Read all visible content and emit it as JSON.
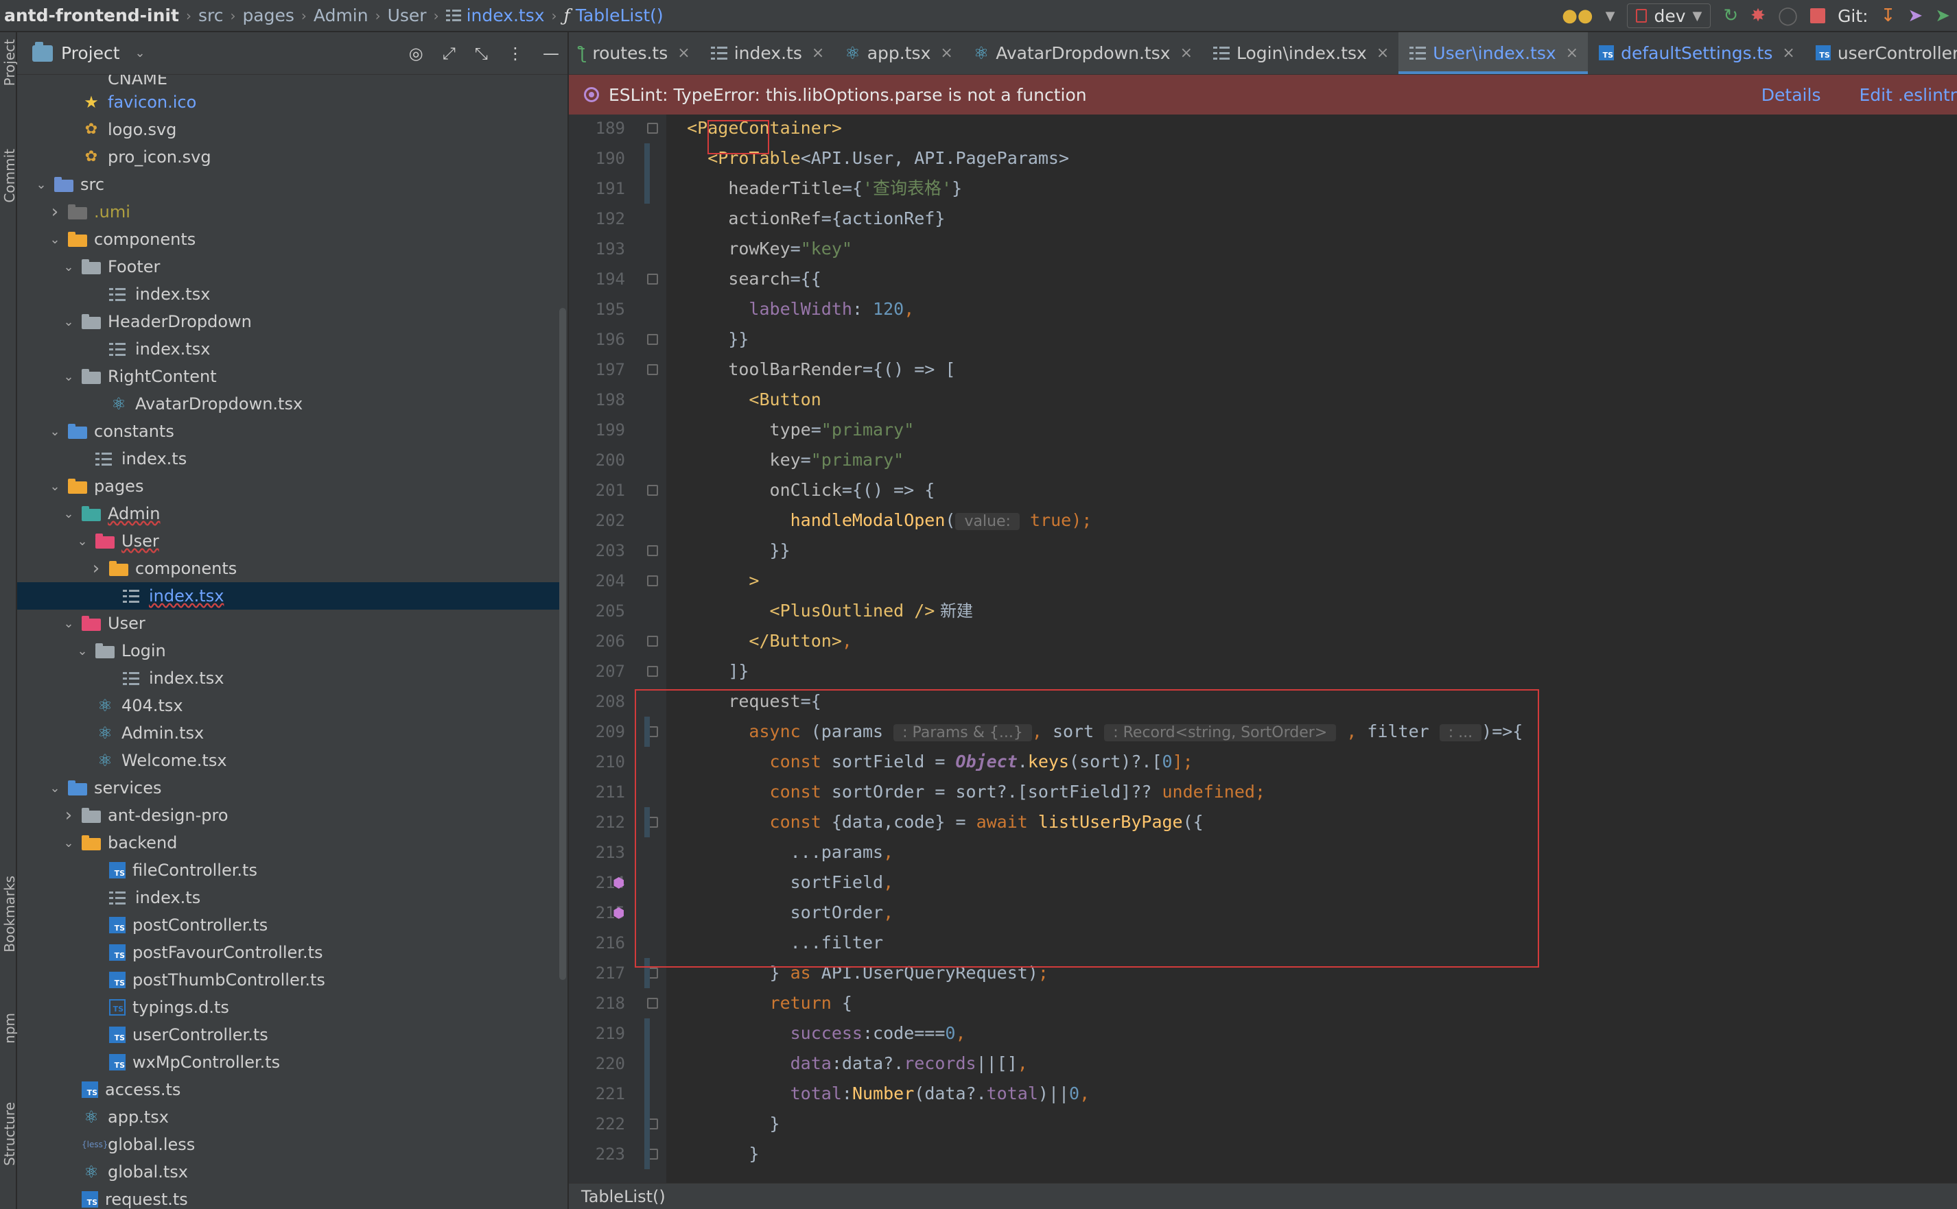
{
  "breadcrumb": [
    {
      "text": "antd-frontend-init",
      "kind": "first"
    },
    {
      "text": "src",
      "kind": "plain"
    },
    {
      "text": "pages",
      "kind": "plain"
    },
    {
      "text": "Admin",
      "kind": "plain"
    },
    {
      "text": "User",
      "kind": "plain"
    },
    {
      "text": "index.tsx",
      "kind": "file"
    },
    {
      "text": "TableList()",
      "kind": "fn"
    }
  ],
  "toolbar": {
    "branch": "dev",
    "git_label": "Git:"
  },
  "side_labels": {
    "project": "Project",
    "commit": "Commit",
    "bookmarks": "Bookmarks",
    "npm": "npm",
    "structure": "Structure"
  },
  "project_panel": {
    "title": "Project",
    "tree": [
      {
        "label": "CNAME",
        "icon": "file",
        "depth": 3,
        "arrow": "",
        "color": ""
      },
      {
        "label": "favicon.ico",
        "icon": "star",
        "depth": 3,
        "arrow": "",
        "color": "blue"
      },
      {
        "label": "logo.svg",
        "icon": "svg",
        "depth": 3,
        "arrow": "",
        "color": ""
      },
      {
        "label": "pro_icon.svg",
        "icon": "svg",
        "depth": 3,
        "arrow": "",
        "color": ""
      },
      {
        "label": "src",
        "icon": "folder-src",
        "depth": 1,
        "arrow": "down",
        "color": ""
      },
      {
        "label": ".umi",
        "icon": "folder-umi",
        "depth": 2,
        "arrow": "right",
        "color": "olive"
      },
      {
        "label": "components",
        "icon": "folder-yel",
        "depth": 2,
        "arrow": "down",
        "color": ""
      },
      {
        "label": "Footer",
        "icon": "folder",
        "depth": 3,
        "arrow": "down",
        "color": ""
      },
      {
        "label": "index.tsx",
        "icon": "lines",
        "depth": 5,
        "arrow": "",
        "color": ""
      },
      {
        "label": "HeaderDropdown",
        "icon": "folder",
        "depth": 3,
        "arrow": "down",
        "color": ""
      },
      {
        "label": "index.tsx",
        "icon": "lines",
        "depth": 5,
        "arrow": "",
        "color": ""
      },
      {
        "label": "RightContent",
        "icon": "folder",
        "depth": 3,
        "arrow": "down",
        "color": ""
      },
      {
        "label": "AvatarDropdown.tsx",
        "icon": "react",
        "depth": 5,
        "arrow": "",
        "color": ""
      },
      {
        "label": "constants",
        "icon": "folder-blue",
        "depth": 2,
        "arrow": "down",
        "color": ""
      },
      {
        "label": "index.ts",
        "icon": "lines",
        "depth": 4,
        "arrow": "",
        "color": ""
      },
      {
        "label": "pages",
        "icon": "folder-yel",
        "depth": 2,
        "arrow": "down",
        "color": ""
      },
      {
        "label": "Admin",
        "icon": "folder-teal",
        "depth": 3,
        "arrow": "down",
        "color": "",
        "wavy": true
      },
      {
        "label": "User",
        "icon": "folder-pink",
        "depth": 4,
        "arrow": "down",
        "color": "",
        "wavy": true
      },
      {
        "label": "components",
        "icon": "folder-yel",
        "depth": 5,
        "arrow": "right",
        "color": ""
      },
      {
        "label": "index.tsx",
        "icon": "lines",
        "depth": 6,
        "arrow": "",
        "color": "",
        "selected": true
      },
      {
        "label": "User",
        "icon": "folder-pink",
        "depth": 3,
        "arrow": "down",
        "color": ""
      },
      {
        "label": "Login",
        "icon": "folder",
        "depth": 4,
        "arrow": "down",
        "color": ""
      },
      {
        "label": "index.tsx",
        "icon": "lines",
        "depth": 6,
        "arrow": "",
        "color": ""
      },
      {
        "label": "404.tsx",
        "icon": "react",
        "depth": 4,
        "arrow": "",
        "color": ""
      },
      {
        "label": "Admin.tsx",
        "icon": "react",
        "depth": 4,
        "arrow": "",
        "color": ""
      },
      {
        "label": "Welcome.tsx",
        "icon": "react",
        "depth": 4,
        "arrow": "",
        "color": ""
      },
      {
        "label": "services",
        "icon": "folder-blue",
        "depth": 2,
        "arrow": "down",
        "color": ""
      },
      {
        "label": "ant-design-pro",
        "icon": "folder",
        "depth": 3,
        "arrow": "right",
        "color": ""
      },
      {
        "label": "backend",
        "icon": "folder-yel",
        "depth": 3,
        "arrow": "down",
        "color": ""
      },
      {
        "label": "fileController.ts",
        "icon": "ts",
        "depth": 5,
        "arrow": "",
        "color": ""
      },
      {
        "label": "index.ts",
        "icon": "lines",
        "depth": 5,
        "arrow": "",
        "color": ""
      },
      {
        "label": "postController.ts",
        "icon": "ts",
        "depth": 5,
        "arrow": "",
        "color": ""
      },
      {
        "label": "postFavourController.ts",
        "icon": "ts",
        "depth": 5,
        "arrow": "",
        "color": ""
      },
      {
        "label": "postThumbController.ts",
        "icon": "ts",
        "depth": 5,
        "arrow": "",
        "color": ""
      },
      {
        "label": "typings.d.ts",
        "icon": "ts-outline",
        "depth": 5,
        "arrow": "",
        "color": ""
      },
      {
        "label": "userController.ts",
        "icon": "ts",
        "depth": 5,
        "arrow": "",
        "color": ""
      },
      {
        "label": "wxMpController.ts",
        "icon": "ts",
        "depth": 5,
        "arrow": "",
        "color": ""
      },
      {
        "label": "access.ts",
        "icon": "ts",
        "depth": 3,
        "arrow": "",
        "color": ""
      },
      {
        "label": "app.tsx",
        "icon": "react",
        "depth": 3,
        "arrow": "",
        "color": ""
      },
      {
        "label": "global.less",
        "icon": "less",
        "depth": 3,
        "arrow": "",
        "color": ""
      },
      {
        "label": "global.tsx",
        "icon": "react",
        "depth": 3,
        "arrow": "",
        "color": ""
      },
      {
        "label": "request.ts",
        "icon": "ts",
        "depth": 3,
        "arrow": "",
        "color": ""
      }
    ]
  },
  "tabs": [
    {
      "label": "routes.ts",
      "icon": "routes",
      "active": false
    },
    {
      "label": "index.ts",
      "icon": "lines",
      "active": false
    },
    {
      "label": "app.tsx",
      "icon": "react",
      "active": false
    },
    {
      "label": "AvatarDropdown.tsx",
      "icon": "react",
      "active": false
    },
    {
      "label": "Login\\index.tsx",
      "icon": "lines",
      "active": false
    },
    {
      "label": "User\\index.tsx",
      "icon": "lines",
      "active": true
    },
    {
      "label": "defaultSettings.ts",
      "icon": "ts",
      "active": false,
      "blue": true
    },
    {
      "label": "userController.ts",
      "icon": "ts",
      "active": false
    }
  ],
  "warning": {
    "message": "ESLint: TypeError: this.libOptions.parse is not a function",
    "details": "Details",
    "edit": "Edit .eslintr"
  },
  "line_numbers": [
    "189",
    "190",
    "191",
    "192",
    "193",
    "194",
    "195",
    "196",
    "197",
    "198",
    "199",
    "200",
    "201",
    "202",
    "203",
    "204",
    "205",
    "206",
    "207",
    "208",
    "209",
    "210",
    "211",
    "212",
    "213",
    "214",
    "215",
    "216",
    "217",
    "218",
    "219",
    "220",
    "221",
    "222",
    "223"
  ],
  "code_lines": [
    [
      {
        "t": "  ",
        "c": "plain"
      },
      {
        "t": "<PageContainer>",
        "c": "tag"
      }
    ],
    [
      {
        "t": "    ",
        "c": "plain"
      },
      {
        "t": "<ProTable",
        "c": "tag"
      },
      {
        "t": "<API.User, API.PageParams>",
        "c": "plain"
      }
    ],
    [
      {
        "t": "      ",
        "c": "plain"
      },
      {
        "t": "headerTitle",
        "c": "attr"
      },
      {
        "t": "={",
        "c": "plain"
      },
      {
        "t": "'查询表格'",
        "c": "str"
      },
      {
        "t": "}",
        "c": "plain"
      }
    ],
    [
      {
        "t": "      ",
        "c": "plain"
      },
      {
        "t": "actionRef",
        "c": "attr"
      },
      {
        "t": "={actionRef}",
        "c": "plain"
      }
    ],
    [
      {
        "t": "      ",
        "c": "plain"
      },
      {
        "t": "rowKey",
        "c": "attr"
      },
      {
        "t": "=",
        "c": "plain"
      },
      {
        "t": "\"key\"",
        "c": "str"
      }
    ],
    [
      {
        "t": "      ",
        "c": "plain"
      },
      {
        "t": "search",
        "c": "attr"
      },
      {
        "t": "={{",
        "c": "plain"
      }
    ],
    [
      {
        "t": "        ",
        "c": "plain"
      },
      {
        "t": "labelWidth",
        "c": "prop"
      },
      {
        "t": ": ",
        "c": "plain"
      },
      {
        "t": "120",
        "c": "num"
      },
      {
        "t": ",",
        "c": "kw"
      }
    ],
    [
      {
        "t": "      ",
        "c": "plain"
      },
      {
        "t": "}}",
        "c": "plain"
      }
    ],
    [
      {
        "t": "      ",
        "c": "plain"
      },
      {
        "t": "toolBarRender",
        "c": "attr"
      },
      {
        "t": "={() => [",
        "c": "plain"
      }
    ],
    [
      {
        "t": "        ",
        "c": "plain"
      },
      {
        "t": "<Button",
        "c": "tag"
      }
    ],
    [
      {
        "t": "          ",
        "c": "plain"
      },
      {
        "t": "type",
        "c": "attr"
      },
      {
        "t": "=",
        "c": "plain"
      },
      {
        "t": "\"primary\"",
        "c": "str"
      }
    ],
    [
      {
        "t": "          ",
        "c": "plain"
      },
      {
        "t": "key",
        "c": "attr"
      },
      {
        "t": "=",
        "c": "plain"
      },
      {
        "t": "\"primary\"",
        "c": "str"
      }
    ],
    [
      {
        "t": "          ",
        "c": "plain"
      },
      {
        "t": "onClick",
        "c": "attr"
      },
      {
        "t": "={() => {",
        "c": "plain"
      }
    ],
    [
      {
        "t": "            ",
        "c": "plain"
      },
      {
        "t": "handleModalOpen",
        "c": "fnc"
      },
      {
        "t": "(",
        "c": "plain"
      },
      {
        "t": " value: ",
        "c": "hint"
      },
      {
        "t": " ",
        "c": "plain"
      },
      {
        "t": "true",
        "c": "kw"
      },
      {
        "t": ");",
        "c": "kw"
      }
    ],
    [
      {
        "t": "          ",
        "c": "plain"
      },
      {
        "t": "}}",
        "c": "plain"
      }
    ],
    [
      {
        "t": "        ",
        "c": "plain"
      },
      {
        "t": ">",
        "c": "tag"
      }
    ],
    [
      {
        "t": "          ",
        "c": "plain"
      },
      {
        "t": "<PlusOutlined />",
        "c": "tag"
      },
      {
        "t": " 新建",
        "c": "cn"
      }
    ],
    [
      {
        "t": "        ",
        "c": "plain"
      },
      {
        "t": "</Button>",
        "c": "tag"
      },
      {
        "t": ",",
        "c": "kw"
      }
    ],
    [
      {
        "t": "      ",
        "c": "plain"
      },
      {
        "t": "]}",
        "c": "plain"
      }
    ],
    [
      {
        "t": "      ",
        "c": "plain"
      },
      {
        "t": "request",
        "c": "attr"
      },
      {
        "t": "={",
        "c": "plain"
      }
    ],
    [
      {
        "t": "        ",
        "c": "plain"
      },
      {
        "t": "async",
        "c": "kw"
      },
      {
        "t": " (params ",
        "c": "plain"
      },
      {
        "t": " : Params & {...} ",
        "c": "hint"
      },
      {
        "t": ", ",
        "c": "kw"
      },
      {
        "t": "sort ",
        "c": "plain"
      },
      {
        "t": " : Record<string, SortOrder> ",
        "c": "hint"
      },
      {
        "t": " , ",
        "c": "kw"
      },
      {
        "t": "filter ",
        "c": "plain"
      },
      {
        "t": " : ... ",
        "c": "hint"
      },
      {
        "t": ")=>{",
        "c": "plain"
      }
    ],
    [
      {
        "t": "          ",
        "c": "plain"
      },
      {
        "t": "const",
        "c": "kw"
      },
      {
        "t": " sortField = ",
        "c": "plain"
      },
      {
        "t": "Object",
        "c": "obj"
      },
      {
        "t": ".",
        "c": "plain"
      },
      {
        "t": "keys",
        "c": "fnc"
      },
      {
        "t": "(sort)?.[",
        "c": "plain"
      },
      {
        "t": "0",
        "c": "num"
      },
      {
        "t": "];",
        "c": "kw"
      }
    ],
    [
      {
        "t": "          ",
        "c": "plain"
      },
      {
        "t": "const",
        "c": "kw"
      },
      {
        "t": " sortOrder = sort?.[sortField]?? ",
        "c": "plain"
      },
      {
        "t": "undefined",
        "c": "kw"
      },
      {
        "t": ";",
        "c": "kw"
      }
    ],
    [
      {
        "t": "          ",
        "c": "plain"
      },
      {
        "t": "const",
        "c": "kw"
      },
      {
        "t": " {data,code} = ",
        "c": "plain"
      },
      {
        "t": "await",
        "c": "kw"
      },
      {
        "t": " ",
        "c": "plain"
      },
      {
        "t": "listUserByPage",
        "c": "fnc"
      },
      {
        "t": "({",
        "c": "plain"
      }
    ],
    [
      {
        "t": "            ...params",
        "c": "plain"
      },
      {
        "t": ",",
        "c": "kw"
      }
    ],
    [
      {
        "t": "            sortField",
        "c": "plain"
      },
      {
        "t": ",",
        "c": "kw"
      }
    ],
    [
      {
        "t": "            sortOrder",
        "c": "plain"
      },
      {
        "t": ",",
        "c": "kw"
      }
    ],
    [
      {
        "t": "            ...filter",
        "c": "plain"
      }
    ],
    [
      {
        "t": "          } ",
        "c": "plain"
      },
      {
        "t": "as",
        "c": "kw"
      },
      {
        "t": " API.UserQueryRequest)",
        "c": "plain"
      },
      {
        "t": ";",
        "c": "kw"
      }
    ],
    [
      {
        "t": "          ",
        "c": "plain"
      },
      {
        "t": "return",
        "c": "kw"
      },
      {
        "t": " {",
        "c": "plain"
      }
    ],
    [
      {
        "t": "            ",
        "c": "plain"
      },
      {
        "t": "success",
        "c": "prop"
      },
      {
        "t": ":code===",
        "c": "plain"
      },
      {
        "t": "0",
        "c": "num"
      },
      {
        "t": ",",
        "c": "kw"
      }
    ],
    [
      {
        "t": "            ",
        "c": "plain"
      },
      {
        "t": "data",
        "c": "prop"
      },
      {
        "t": ":data?.",
        "c": "plain"
      },
      {
        "t": "records",
        "c": "prop"
      },
      {
        "t": "||[]",
        "c": "plain"
      },
      {
        "t": ",",
        "c": "kw"
      }
    ],
    [
      {
        "t": "            ",
        "c": "plain"
      },
      {
        "t": "total",
        "c": "prop"
      },
      {
        "t": ":",
        "c": "plain"
      },
      {
        "t": "Number",
        "c": "fnc"
      },
      {
        "t": "(data?.",
        "c": "plain"
      },
      {
        "t": "total",
        "c": "prop"
      },
      {
        "t": ")||",
        "c": "plain"
      },
      {
        "t": "0",
        "c": "num"
      },
      {
        "t": ",",
        "c": "kw"
      }
    ],
    [
      {
        "t": "          }",
        "c": "plain"
      }
    ],
    [
      {
        "t": "        }",
        "c": "plain"
      }
    ]
  ],
  "status": {
    "function": "TableList()"
  }
}
